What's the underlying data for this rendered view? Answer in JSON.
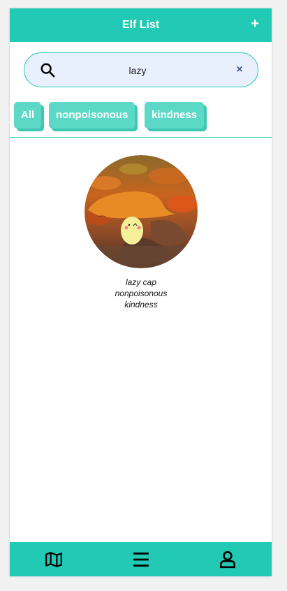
{
  "header": {
    "title": "Elf List",
    "add_label": "+"
  },
  "search": {
    "value": "lazy",
    "clear_label": "×"
  },
  "filters": [
    {
      "label": "All"
    },
    {
      "label": "nonpoisonous"
    },
    {
      "label": "kindness"
    }
  ],
  "results": [
    {
      "name": "lazy cap",
      "tag1": "nonpoisonous",
      "tag2": "kindness"
    }
  ],
  "bottom_nav": {
    "items": [
      {
        "icon": "map-icon"
      },
      {
        "icon": "menu-icon"
      },
      {
        "icon": "user-icon"
      }
    ]
  },
  "colors": {
    "accent": "#22c9b4",
    "chip": "#5cd8c6",
    "search_bg": "#e8f0fe"
  }
}
